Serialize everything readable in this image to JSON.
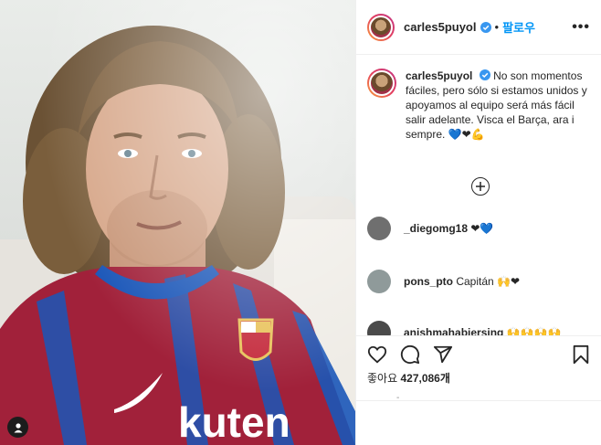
{
  "header": {
    "username": "carles5puyol",
    "separator": "•",
    "follow_label": "팔로우",
    "more_label": "•••"
  },
  "caption": {
    "username": "carles5puyol",
    "text": "No son momentos fáciles, pero sólo si estamos unidos y apoyamos al equipo será más fácil salir adelante. Visca el Barça, ara i sempre.",
    "emoji": "💙❤💪"
  },
  "comments": [
    {
      "username": "_diegomg18",
      "text": "❤💙",
      "avatar_color": "#6f6f6f"
    },
    {
      "username": "pons_pto",
      "text": "Capitán 🙌❤",
      "avatar_color": "#8f9a9a"
    },
    {
      "username": "anishmahabiersing",
      "text": "🙌🙌🙌🙌",
      "avatar_color": "#4a4a4a"
    }
  ],
  "likes": {
    "label": "좋아요",
    "count": "427,086개"
  },
  "time": "-",
  "icons": [
    "heart-icon",
    "comment-icon",
    "share-icon",
    "bookmark-icon",
    "plus-circle-icon",
    "user-tag-icon",
    "verified-icon"
  ],
  "colors": {
    "accent": "#0095f6",
    "barca_red": "#a1213a",
    "barca_blue": "#1a56b8"
  }
}
